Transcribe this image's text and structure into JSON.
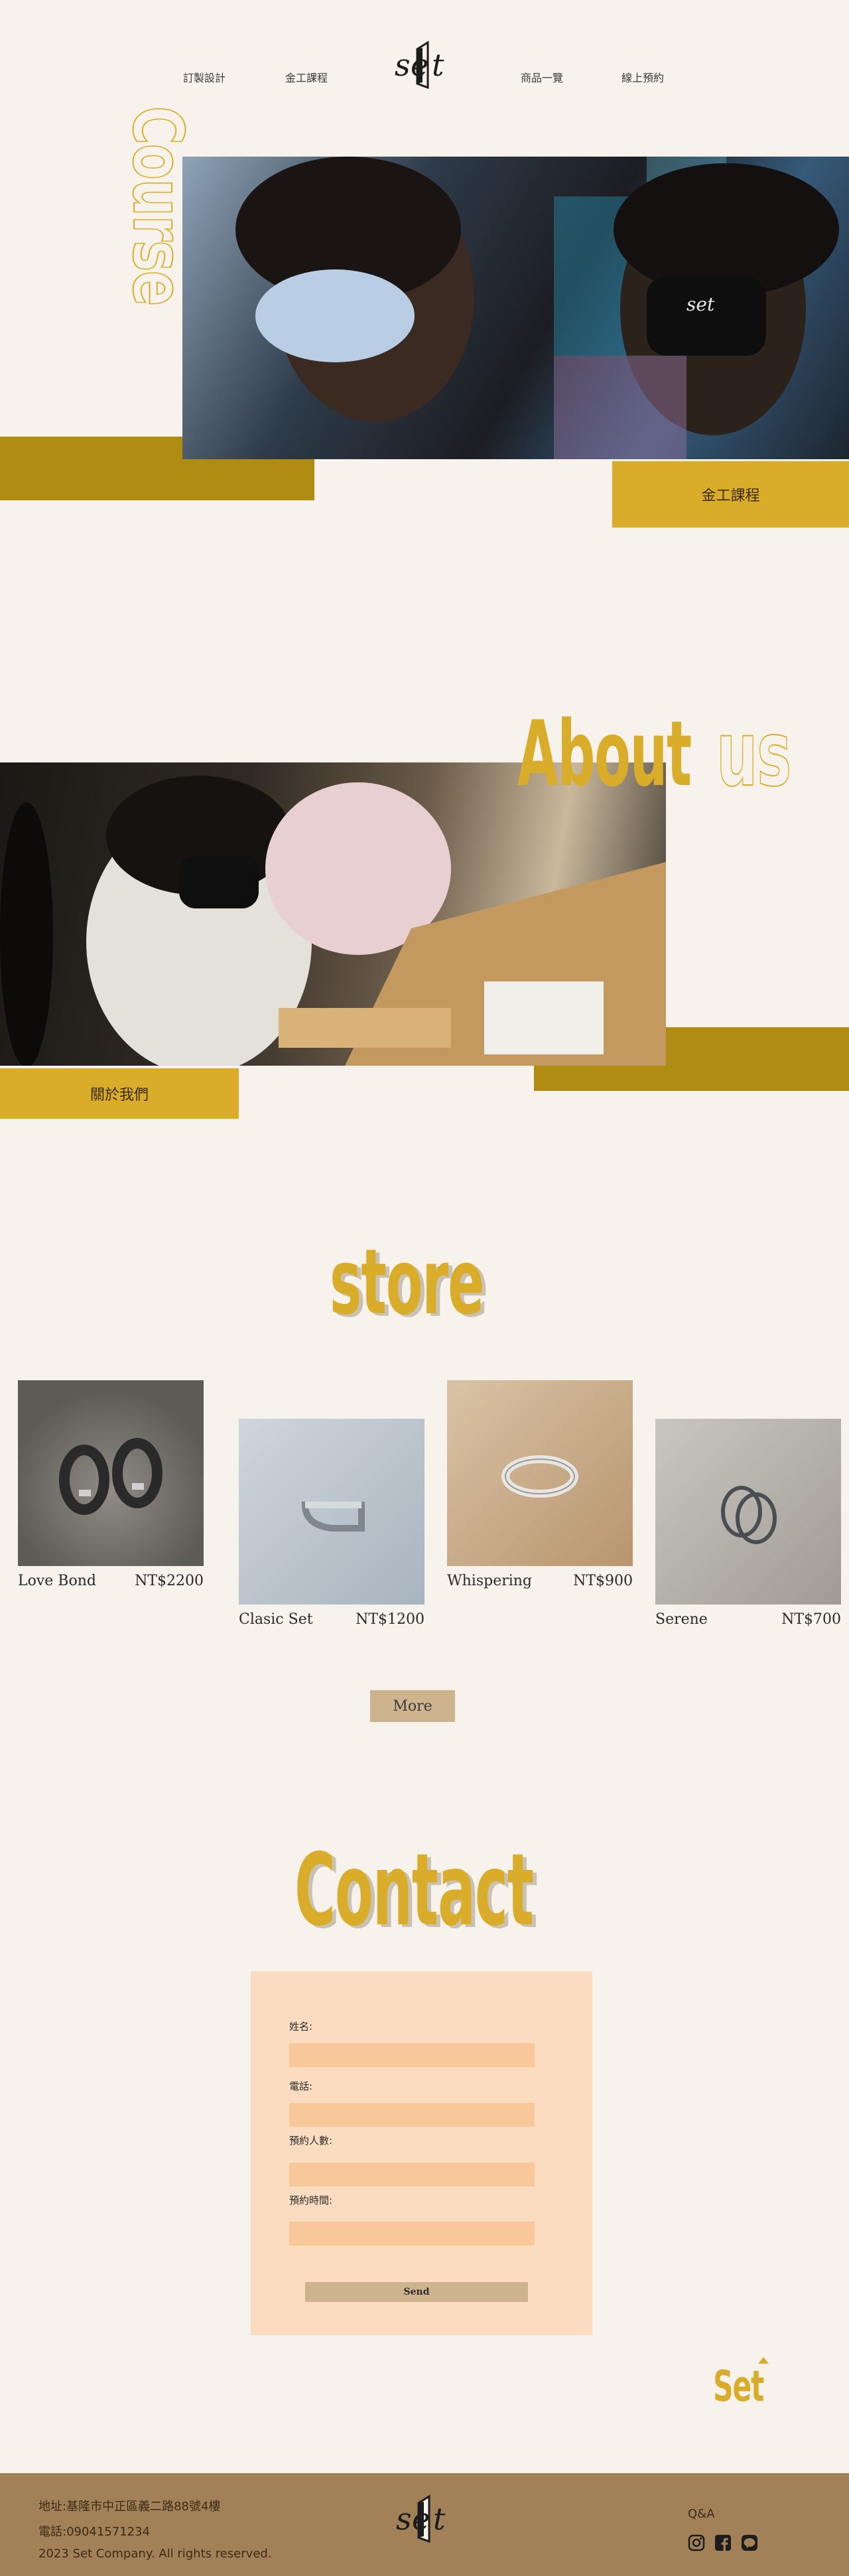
{
  "nav": {
    "items": [
      "訂製設計",
      "金工課程",
      "商品一覽",
      "線上預約"
    ]
  },
  "course": {
    "vertical_word": "Course",
    "cta_label": "金工課程"
  },
  "about": {
    "title_solid": "About",
    "title_outline": "us",
    "cta_label": "關於我們"
  },
  "store": {
    "title": "store",
    "products": [
      {
        "name": "Love Bond",
        "price": "NT$2200"
      },
      {
        "name": "Clasic Set",
        "price": "NT$1200"
      },
      {
        "name": "Whispering",
        "price": "NT$900"
      },
      {
        "name": "Serene",
        "price": "NT$700"
      }
    ],
    "more_label": "More"
  },
  "contact": {
    "title": "Contact",
    "fields": [
      {
        "label": "姓名:",
        "value": ""
      },
      {
        "label": "電話:",
        "value": ""
      },
      {
        "label": "預約人數:",
        "value": ""
      },
      {
        "label": "預約時間:",
        "value": ""
      }
    ],
    "send_label": "Send",
    "set_mark": "Set"
  },
  "footer": {
    "address": "地址:基隆市中正區義二路88號4樓",
    "phone": "電話:09041571234",
    "copyright": "2023 Set Company. All rights reserved.",
    "qa_label": "Q&A",
    "social_icons": [
      "instagram-icon",
      "facebook-icon",
      "line-icon"
    ]
  },
  "colors": {
    "background": "#f7f3ec",
    "gold": "#d9ad2a",
    "olive": "#b08c12",
    "footer": "#a38158",
    "form_panel": "#fbdcc1",
    "form_input": "#f8c79a",
    "button": "#cdb48f"
  }
}
